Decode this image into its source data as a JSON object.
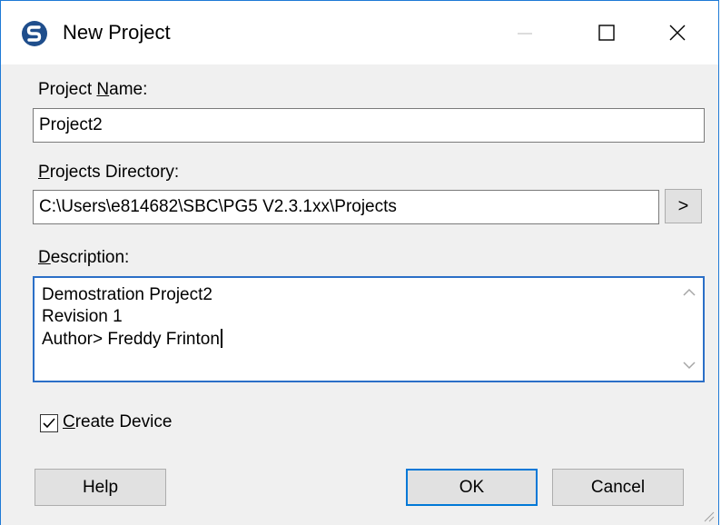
{
  "window": {
    "title": "New Project",
    "icon": "saia-pg5-app-icon",
    "accent_color": "#1e7ad6"
  },
  "caption_buttons": {
    "minimize_icon": "minimize-icon",
    "maximize_icon": "maximize-icon",
    "close_icon": "close-icon"
  },
  "fields": {
    "project_name": {
      "label_prefix": "Project ",
      "label_mnemonic": "N",
      "label_suffix": "ame:",
      "value": "Project2"
    },
    "projects_directory": {
      "label_prefix": "",
      "label_mnemonic": "P",
      "label_suffix": "rojects Directory:",
      "value": "C:\\Users\\e814682\\SBC\\PG5 V2.3.1xx\\Projects",
      "browse_label": ">"
    },
    "description": {
      "label_prefix": "",
      "label_mnemonic": "D",
      "label_suffix": "escription:",
      "lines": [
        "Demostration Project2",
        "Revision 1",
        "Author> Freddy Frinton"
      ]
    }
  },
  "create_device": {
    "checked": true,
    "label_mnemonic": "C",
    "label_suffix": "reate Device"
  },
  "buttons": {
    "help": "Help",
    "ok": "OK",
    "cancel": "Cancel"
  }
}
